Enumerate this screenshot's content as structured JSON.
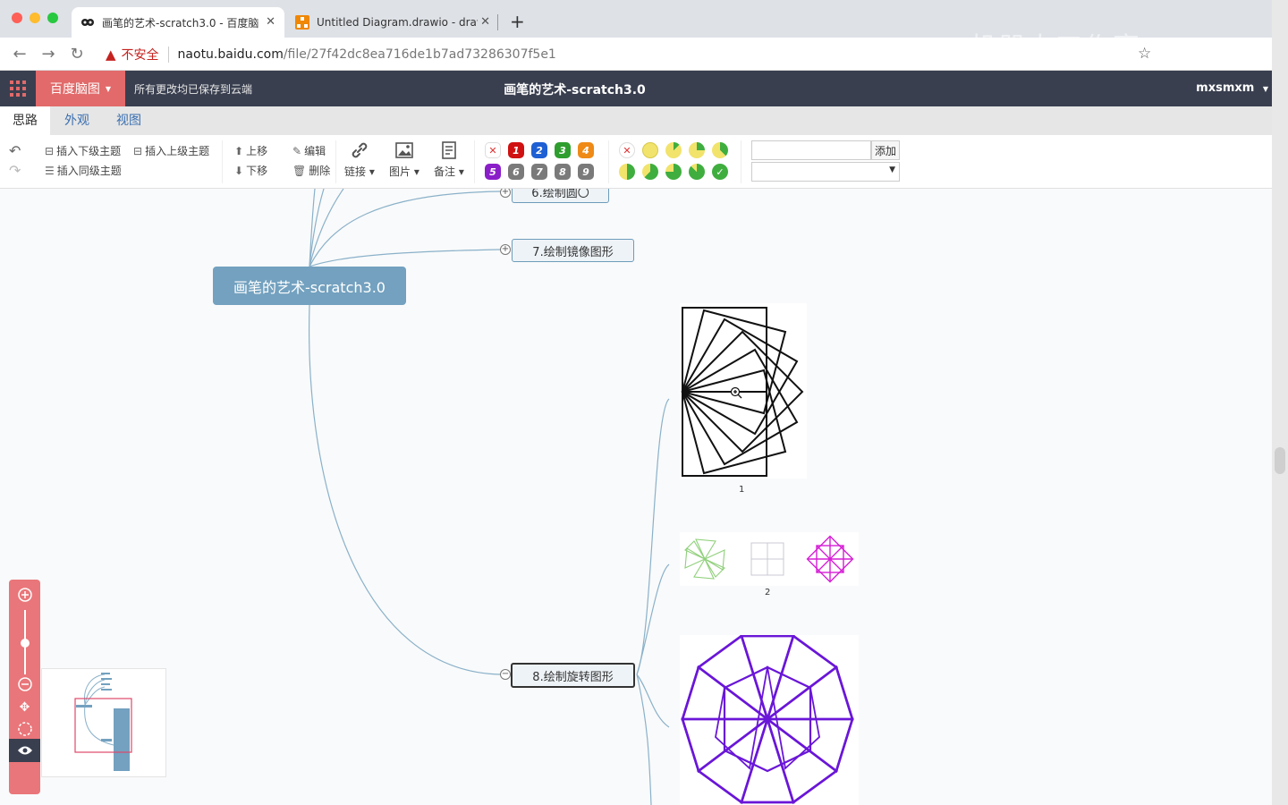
{
  "browser": {
    "tabs": [
      {
        "title": "画笔的艺术-scratch3.0 - 百度脑",
        "active": true
      },
      {
        "title": "Untitled Diagram.drawio - draw",
        "active": false
      }
    ],
    "new_tab": "+",
    "insecure_label": "不安全",
    "url_host": "naotu.baidu.com",
    "url_path": "/file/27f42dc8ea716de1b7ad73286307f5e1",
    "watermark": "——机器人工作室"
  },
  "app": {
    "brand": "百度脑图",
    "save_status": "所有更改均已保存到云端",
    "doc_title": "画笔的艺术-scratch3.0",
    "user": "mxsmxm"
  },
  "ribbon_tabs": [
    "思路",
    "外观",
    "视图"
  ],
  "toolbar": {
    "insert_child": "插入下级主题",
    "insert_parent": "插入上级主题",
    "insert_sibling": "插入同级主题",
    "move_up": "上移",
    "move_down": "下移",
    "edit": "编辑",
    "delete": "删除",
    "link": "链接",
    "image": "图片",
    "note": "备注",
    "priorities_top": [
      "1",
      "2",
      "3",
      "4"
    ],
    "priorities_bottom": [
      "5",
      "6",
      "7",
      "8",
      "9"
    ],
    "tag_add": "添加"
  },
  "colors": {
    "appbar": "#393f4f",
    "brand": "#e26a6a",
    "root": "#73a1bf",
    "zoom": "#e9767a",
    "purple": "#6a16d8",
    "magenta": "#d61fd6",
    "green": "#8fd07a"
  },
  "mindmap": {
    "root": "画笔的艺术-scratch3.0",
    "nodes": [
      "6.绘制圆〇",
      "7.绘制镜像图形",
      "8.绘制旋转图形"
    ],
    "figure_labels": [
      "1",
      "2"
    ]
  }
}
